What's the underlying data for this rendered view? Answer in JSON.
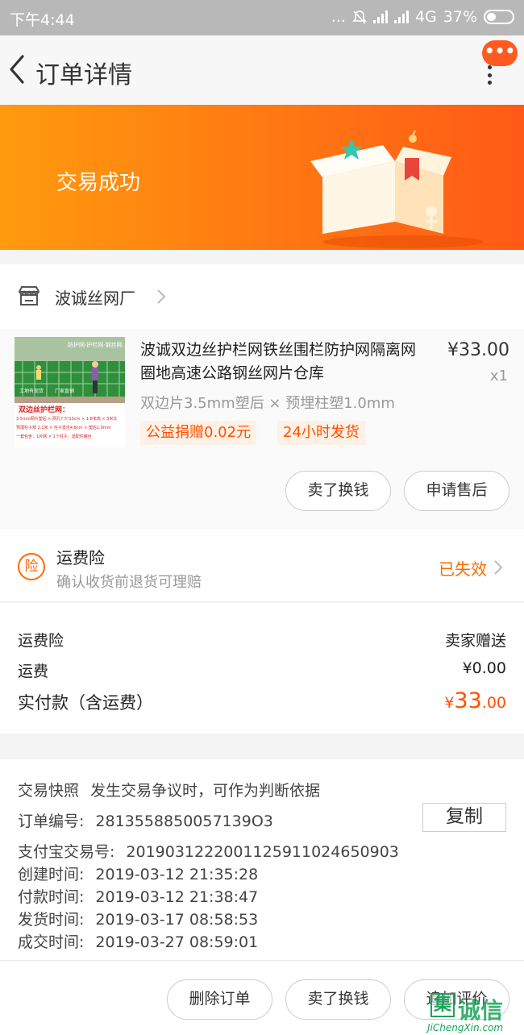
{
  "status_bar": {
    "time": "下午4:44",
    "dots": "...",
    "network": "4G",
    "battery": "37%"
  },
  "nav": {
    "title": "订单详情",
    "message_badge": "•••"
  },
  "banner": {
    "status": "交易成功"
  },
  "shop": {
    "name": "波诚丝网厂"
  },
  "item": {
    "title": "波诚双边丝护栏网铁丝围栏防护网隔离网圈地高速公路钢丝网片仓库",
    "price": "¥33.00",
    "quantity": "x1",
    "sku": "双边片3.5mm塑后 × 预埋柱塑1.0mm",
    "tags": [
      "公益捐赠0.02元",
      "24小时发货"
    ],
    "image_text": {
      "top_caption": "防护网·护栏网·钢丝网",
      "left_caption": "工地有现货",
      "right_caption": "厂家直销",
      "heading": "双边丝护栏网：",
      "lines": [
        "3.5mm网片塑后 × 网孔7.5*15cm × 1.8米高 × 3米长",
        "预埋柱子规 2.1米 × 柱子直径4.8cm × 塑后1.0mm",
        "一套包含：1片网 × 1个柱子，送配件螺丝"
      ]
    },
    "buttons": {
      "sell": "卖了换钱",
      "after_sale": "申请售后"
    }
  },
  "insurance": {
    "badge": "险",
    "title": "运费险",
    "subtitle": "确认收货前退货可理赔",
    "status": "已失效"
  },
  "fees": {
    "insurance_label": "运费险",
    "insurance_value": "卖家赠送",
    "shipping_label": "运费",
    "shipping_value": "¥0.00",
    "total_label": "实付款（含运费）",
    "total_currency": "¥",
    "total_int": "33",
    "total_dec": ".00"
  },
  "order_info": {
    "snapshot_label": "交易快照",
    "snapshot_desc": "发生交易争议时，可作为判断依据",
    "order_no_label": "订单编号:",
    "order_no": "2813558850057139O3",
    "copy_label": "复制",
    "alipay_label": "支付宝交易号:",
    "alipay_no": "2019031222001125911024650903",
    "created_label": "创建时间:",
    "created": "2019-03-12 21:35:28",
    "paid_label": "付款时间:",
    "paid": "2019-03-12 21:38:47",
    "shipped_label": "发货时间:",
    "shipped": "2019-03-17 08:58:53",
    "completed_label": "成交时间:",
    "completed": "2019-03-27 08:59:01"
  },
  "bottom_bar": {
    "delete": "删除订单",
    "sell": "卖了换钱",
    "review": "追加评价"
  },
  "watermark": {
    "box_char": "集",
    "text": "诚信",
    "url": "JiChengXin.com"
  },
  "colors": {
    "accent": "#ff5000",
    "banner_start": "#ff9a0e",
    "banner_end": "#ff5a16"
  }
}
